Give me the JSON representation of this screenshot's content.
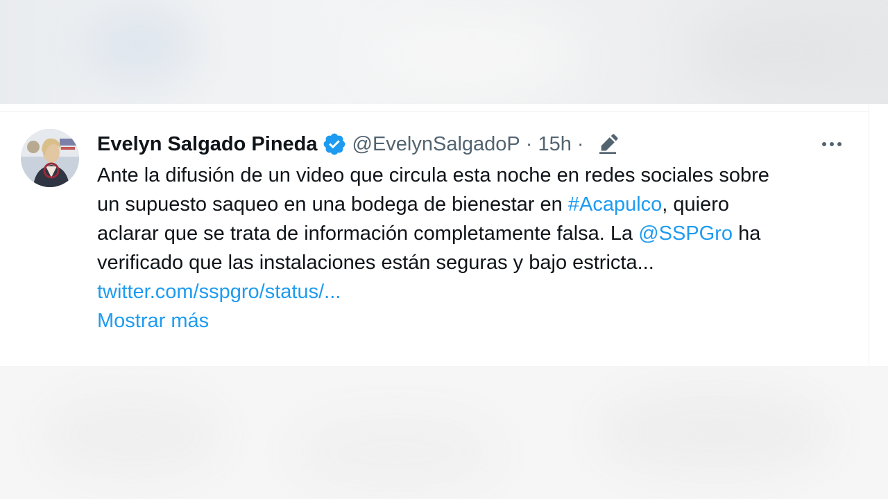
{
  "tweet": {
    "author_name": "Evelyn Salgado Pineda",
    "handle": "@EvelynSalgadoP",
    "separator": "·",
    "time": "15h",
    "text": {
      "line1": "Ante la difusión de un video que circula esta noche en redes sociales sobre",
      "line2_before": "un supuesto saqueo en una bodega de bienestar en ",
      "hashtag": "#Acapulco",
      "line2_after": ", quiero",
      "line3_before": "aclarar que se trata de información completamente falsa. La ",
      "mention": "@SSPGro",
      "line3_after": " ha",
      "line4": "verificado que las instalaciones están seguras y bajo estricta...",
      "url": "twitter.com/sspgro/status/..."
    },
    "show_more": "Mostrar más"
  },
  "icons": {
    "verified": "verified-badge-icon",
    "edit": "edited-pencil-icon",
    "more": "more-options-icon"
  },
  "colors": {
    "text": "#0f1419",
    "secondary": "#536471",
    "accent": "#1d9bf0"
  }
}
